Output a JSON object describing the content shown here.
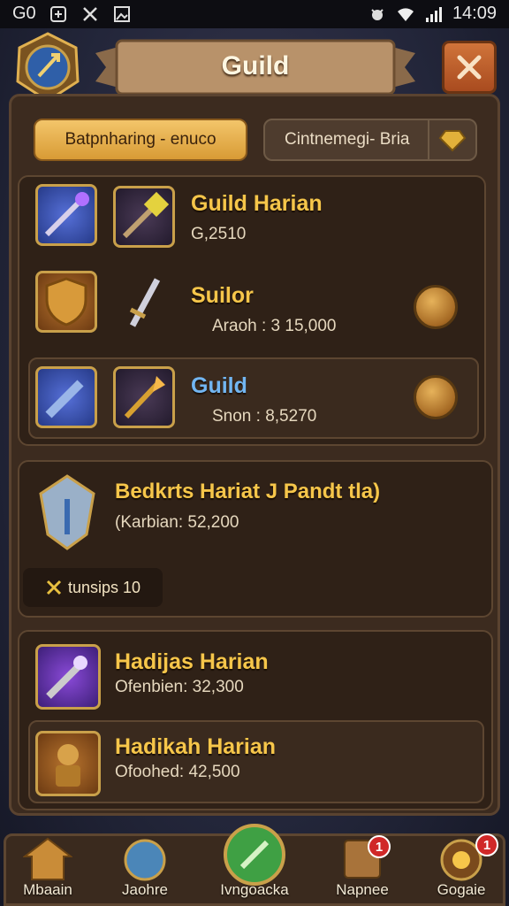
{
  "status_bar": {
    "left": "G0",
    "time": "14:09"
  },
  "header": {
    "title": "Guild"
  },
  "tabs": {
    "active": "Batpnharing - enuco",
    "inactive": "Cintnemegi- Bria"
  },
  "guild_list": [
    {
      "name": "Guild Harian",
      "value": "G,2510"
    },
    {
      "name": "Suilor",
      "value": "Araoh : 3 15,000"
    },
    {
      "name": "Guild",
      "value": "Snon : 8,5270"
    }
  ],
  "featured": {
    "name": "Bedkrts Hariat J Pandt tla)",
    "value": "(Karbian: 52,200",
    "pill": "tunsips 10"
  },
  "bottom_list": [
    {
      "name": "Hadijas Harian",
      "value": "Ofenbien: 32,300"
    },
    {
      "name": "Hadikah Harian",
      "value": "Ofoohed: 42,500"
    }
  ],
  "nav": [
    {
      "label": "Mbaain",
      "badge": ""
    },
    {
      "label": "Jaohre",
      "badge": ""
    },
    {
      "label": "Ivngoacka",
      "badge": ""
    },
    {
      "label": "Napnee",
      "badge": "1"
    },
    {
      "label": "Gogaie",
      "badge": "1"
    }
  ],
  "colors": {
    "gold": "#f6c64a",
    "blue_name": "#72b6f2",
    "panel": "#3c2b1f",
    "accent": "#d89b35"
  }
}
